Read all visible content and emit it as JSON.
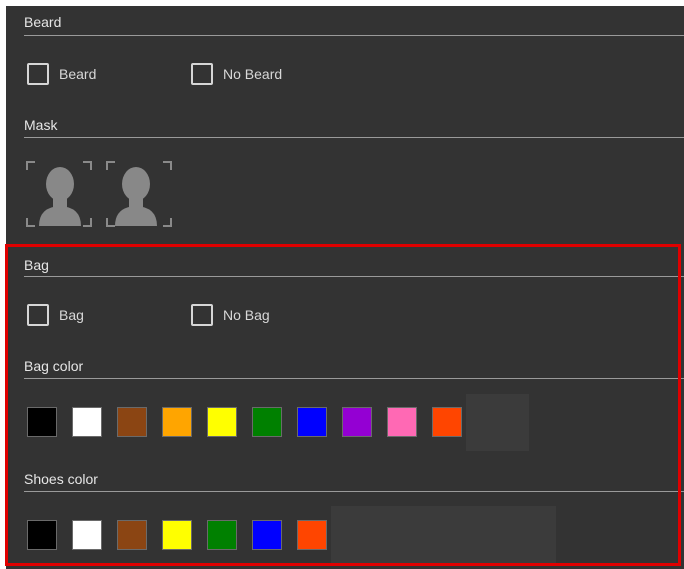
{
  "beard": {
    "header": "Beard",
    "options": [
      {
        "label": "Beard",
        "checked": false
      },
      {
        "label": "No Beard",
        "checked": false
      }
    ]
  },
  "mask": {
    "header": "Mask",
    "options": [
      {
        "icon": "head-silhouette-icon"
      },
      {
        "icon": "head-silhouette-icon"
      }
    ]
  },
  "bag": {
    "header": "Bag",
    "options": [
      {
        "label": "Bag",
        "checked": false
      },
      {
        "label": "No Bag",
        "checked": false
      }
    ]
  },
  "bag_color": {
    "header": "Bag color",
    "swatches": [
      {
        "name": "black",
        "color": "#000000"
      },
      {
        "name": "white",
        "color": "#ffffff"
      },
      {
        "name": "brown",
        "color": "#8b4513"
      },
      {
        "name": "orange",
        "color": "#ffa500"
      },
      {
        "name": "yellow",
        "color": "#ffff00"
      },
      {
        "name": "green",
        "color": "#008000"
      },
      {
        "name": "blue",
        "color": "#0000ff"
      },
      {
        "name": "purple",
        "color": "#9400d3"
      },
      {
        "name": "pink",
        "color": "#ff69b4"
      },
      {
        "name": "red-orange",
        "color": "#ff4500"
      }
    ]
  },
  "shoes_color": {
    "header": "Shoes color",
    "swatches": [
      {
        "name": "black",
        "color": "#000000"
      },
      {
        "name": "white",
        "color": "#ffffff"
      },
      {
        "name": "brown",
        "color": "#8b4513"
      },
      {
        "name": "yellow",
        "color": "#ffff00"
      },
      {
        "name": "green",
        "color": "#008000"
      },
      {
        "name": "blue",
        "color": "#0000ff"
      },
      {
        "name": "red-orange",
        "color": "#ff4500"
      }
    ]
  },
  "highlight_color": "#e00000"
}
